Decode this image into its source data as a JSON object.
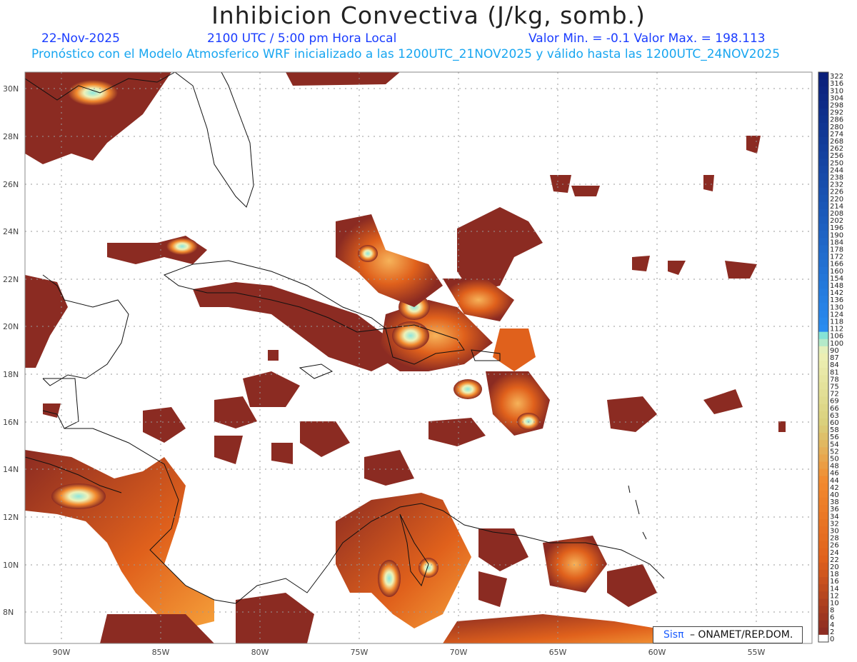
{
  "header": {
    "title": "Inhibicion Convectiva (J/kg, somb.)",
    "date": "22-Nov-2025",
    "time": "2100 UTC / 5:00 pm Hora Local",
    "minmax": "Valor Min. = -0.1  Valor Max. = 198.113",
    "model_line": "Pronóstico con el Modelo Atmosferico WRF inicializado a las 1200UTC_21NOV2025 y válido hasta las  1200UTC_24NOV2025"
  },
  "map": {
    "lat_labels": [
      "30N",
      "28N",
      "26N",
      "24N",
      "22N",
      "20N",
      "18N",
      "16N",
      "14N",
      "12N",
      "10N",
      "8N"
    ],
    "lon_labels": [
      "90W",
      "85W",
      "80W",
      "75W",
      "70W",
      "65W",
      "60W",
      "55W"
    ],
    "credit_brand": "Sisπ",
    "credit_org": "– ONAMET/REP.DOM."
  },
  "colorbar": {
    "labels": [
      "322",
      "316",
      "310",
      "304",
      "298",
      "292",
      "286",
      "280",
      "274",
      "268",
      "262",
      "256",
      "250",
      "244",
      "238",
      "232",
      "226",
      "220",
      "214",
      "208",
      "202",
      "196",
      "190",
      "184",
      "178",
      "172",
      "166",
      "160",
      "154",
      "148",
      "142",
      "136",
      "130",
      "124",
      "118",
      "112",
      "106",
      "100",
      "90",
      "87",
      "84",
      "81",
      "78",
      "75",
      "72",
      "69",
      "66",
      "63",
      "60",
      "58",
      "56",
      "54",
      "52",
      "50",
      "48",
      "46",
      "44",
      "42",
      "40",
      "38",
      "36",
      "34",
      "32",
      "30",
      "28",
      "26",
      "24",
      "22",
      "20",
      "18",
      "16",
      "14",
      "12",
      "10",
      "8",
      "6",
      "4",
      "2",
      "0"
    ],
    "colors": {
      "low": "#8b2b22",
      "mid": "#e0611c",
      "orange": "#f28a2e",
      "yellow": "#d9cf7a",
      "pale": "#eef2b8",
      "cyan": "#7fe2d8",
      "blue": "#2a8cf0",
      "navy": "#0a1f7a"
    }
  }
}
